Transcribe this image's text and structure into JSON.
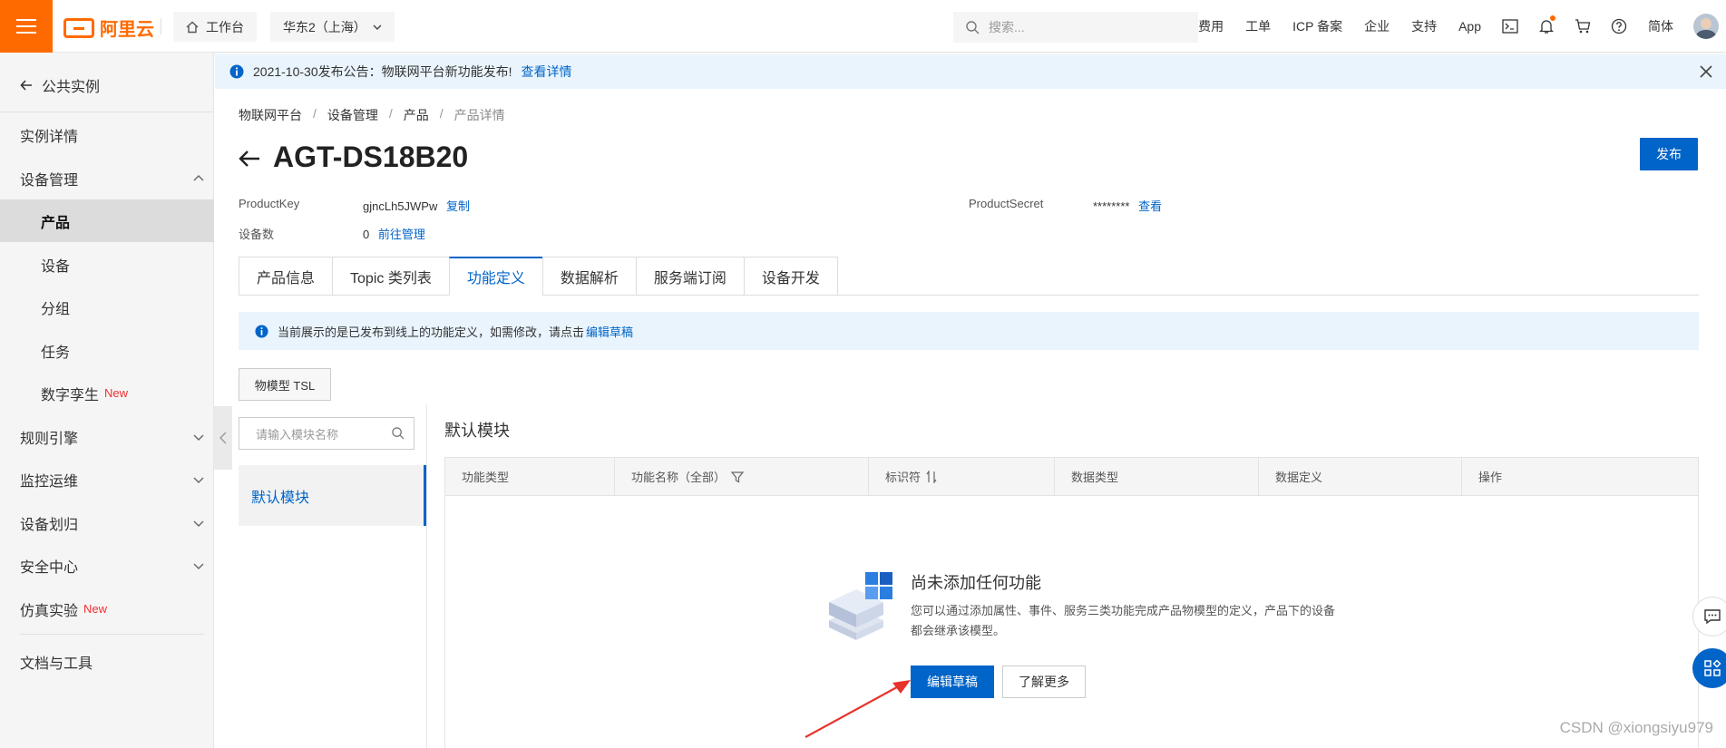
{
  "topbar": {
    "brand": "阿里云",
    "workbench": "工作台",
    "region": "华东2（上海）",
    "search_placeholder": "搜索...",
    "links": [
      "费用",
      "工单",
      "ICP 备案",
      "企业",
      "支持",
      "App"
    ],
    "lang": "简体"
  },
  "sidebar": {
    "back_label": "公共实例",
    "items": [
      {
        "label": "实例详情"
      },
      {
        "label": "设备管理"
      },
      {
        "label": "产品"
      },
      {
        "label": "设备"
      },
      {
        "label": "分组"
      },
      {
        "label": "任务"
      },
      {
        "label": "数字孪生",
        "badge": "New"
      },
      {
        "label": "规则引擎"
      },
      {
        "label": "监控运维"
      },
      {
        "label": "设备划归"
      },
      {
        "label": "安全中心"
      },
      {
        "label": "仿真实验",
        "badge": "New"
      },
      {
        "label": "文档与工具"
      }
    ]
  },
  "notice": {
    "text": "2021-10-30发布公告：物联网平台新功能发布!",
    "link": "查看详情"
  },
  "breadcrumb": [
    "物联网平台",
    "设备管理",
    "产品",
    "产品详情"
  ],
  "product": {
    "title": "AGT-DS18B20",
    "publish_label": "发布",
    "product_key_label": "ProductKey",
    "product_key_value": "gjncLh5JWPw",
    "copy_label": "复制",
    "device_count_label": "设备数",
    "device_count_value": "0",
    "manage_label": "前往管理",
    "product_secret_label": "ProductSecret",
    "product_secret_value": "********",
    "view_label": "查看"
  },
  "tabs": [
    "产品信息",
    "Topic 类列表",
    "功能定义",
    "数据解析",
    "服务端订阅",
    "设备开发"
  ],
  "info_bar": {
    "text": "当前展示的是已发布到线上的功能定义，如需修改，请点击",
    "link": "编辑草稿"
  },
  "tsl_button": "物模型 TSL",
  "module_search_placeholder": "请输入模块名称",
  "module_item": "默认模块",
  "module_title": "默认模块",
  "table_headers": [
    "功能类型",
    "功能名称（全部）",
    "标识符",
    "数据类型",
    "数据定义",
    "操作"
  ],
  "empty": {
    "title": "尚未添加任何功能",
    "desc": "您可以通过添加属性、事件、服务三类功能完成产品物模型的定义，产品下的设备都会继承该模型。",
    "primary": "编辑草稿",
    "secondary": "了解更多"
  },
  "watermark": "CSDN @xiongsiyu979",
  "colors": {
    "brand_orange": "#ff6a00",
    "primary_blue": "#0064c8",
    "notice_bg": "#e9f4fd",
    "annotation_red": "#e8332a"
  }
}
